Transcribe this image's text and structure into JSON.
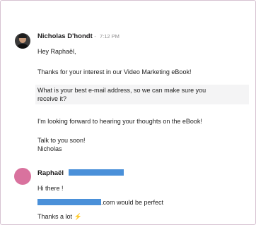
{
  "messages": [
    {
      "sender": "Nicholas D'hondt",
      "time": "7:12 PM",
      "lines": {
        "greeting": "Hey Raphaël,",
        "l1": "Thanks for your interest in our Video Marketing eBook!",
        "l2a": "What is your best e-mail address, so we can make sure you",
        "l2b": "receive it?",
        "l3": "I'm looking forward to hearing your thoughts on the eBook!",
        "l4a": "Talk to you soon!",
        "l4b": "Nicholas"
      }
    },
    {
      "sender": "Raphaël",
      "lines": {
        "l1": "Hi there !",
        "email_suffix": ".com would be perfect",
        "l3": "Thanks a lot"
      }
    }
  ],
  "icons": {
    "bolt": "lightning-bolt-emoji"
  },
  "colors": {
    "redaction": "#4a90d9",
    "avatar_pink": "#d9729e",
    "frame_border": "#d7c2d2"
  }
}
